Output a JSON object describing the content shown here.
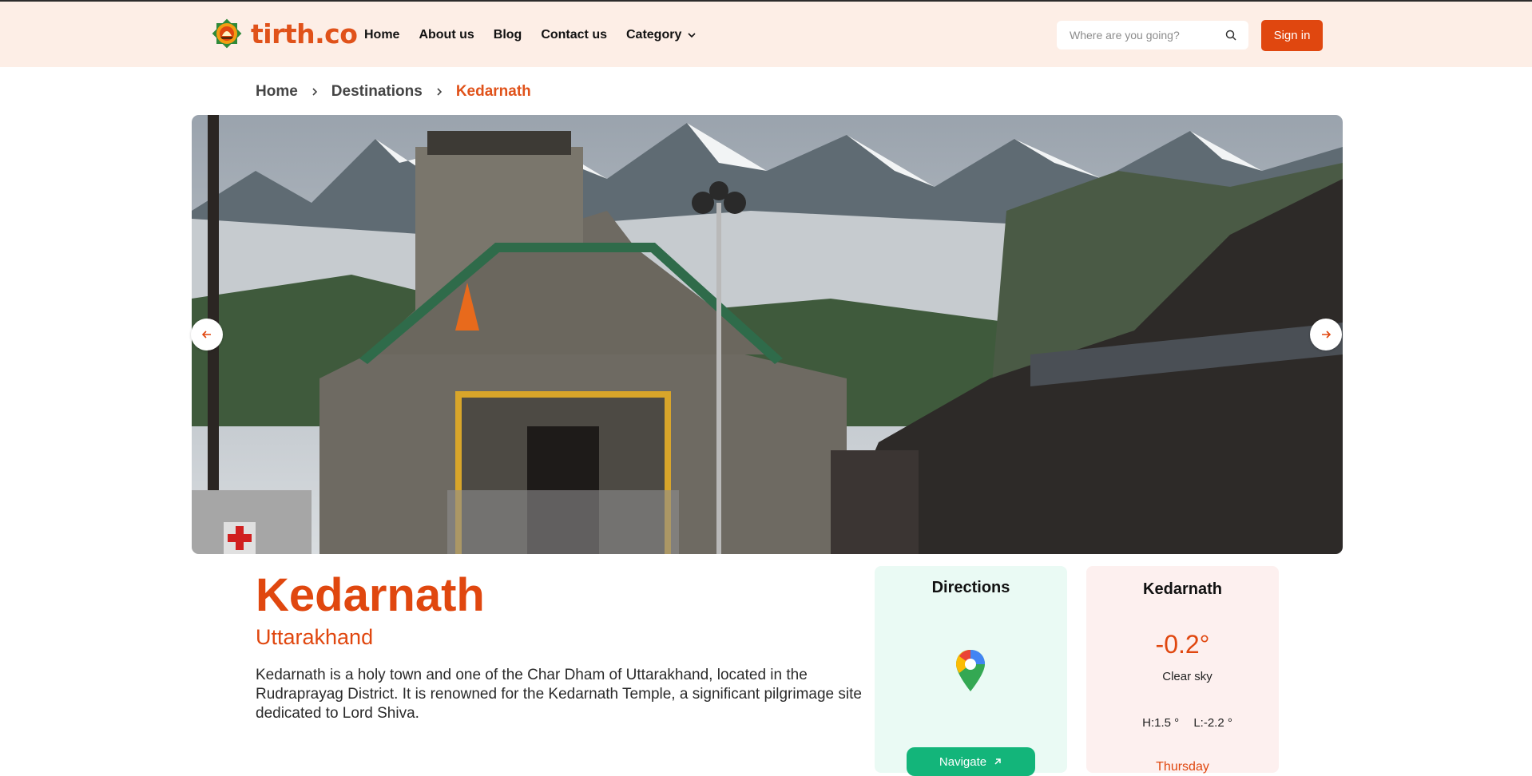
{
  "app": {
    "brand": "tirth.co",
    "accent": "#e0470f",
    "header_bg": "#fdeee6"
  },
  "nav": {
    "items": [
      {
        "label": "Home"
      },
      {
        "label": "About us"
      },
      {
        "label": "Blog"
      },
      {
        "label": "Contact us"
      },
      {
        "label": "Category"
      }
    ],
    "category_icon": "chevron-down-icon"
  },
  "search": {
    "placeholder": "Where are you going?",
    "value": "",
    "icon": "search-icon"
  },
  "auth": {
    "signin_label": "Sign in"
  },
  "breadcrumb": {
    "items": [
      "Home",
      "Destinations"
    ],
    "current": "Kedarnath"
  },
  "hero": {
    "alt": "Kedarnath Temple",
    "prev_icon": "arrow-left-icon",
    "next_icon": "arrow-right-icon"
  },
  "place": {
    "name": "Kedarnath",
    "state": "Uttarakhand",
    "description": "Kedarnath is a holy town and one of the Char Dham of Uttarakhand, located in the Rudraprayag District. It is renowned for the Kedarnath Temple, a significant pilgrimage site dedicated to Lord Shiva."
  },
  "directions": {
    "title": "Directions",
    "navigate_label": "Navigate",
    "map_icon": "map-pin-icon",
    "color": "#13b57a"
  },
  "weather": {
    "location": "Kedarnath",
    "temperature": "-0.2°",
    "condition": "Clear sky",
    "high": "H:1.5 °",
    "low": "L:-2.2 °",
    "day": "Thursday"
  }
}
